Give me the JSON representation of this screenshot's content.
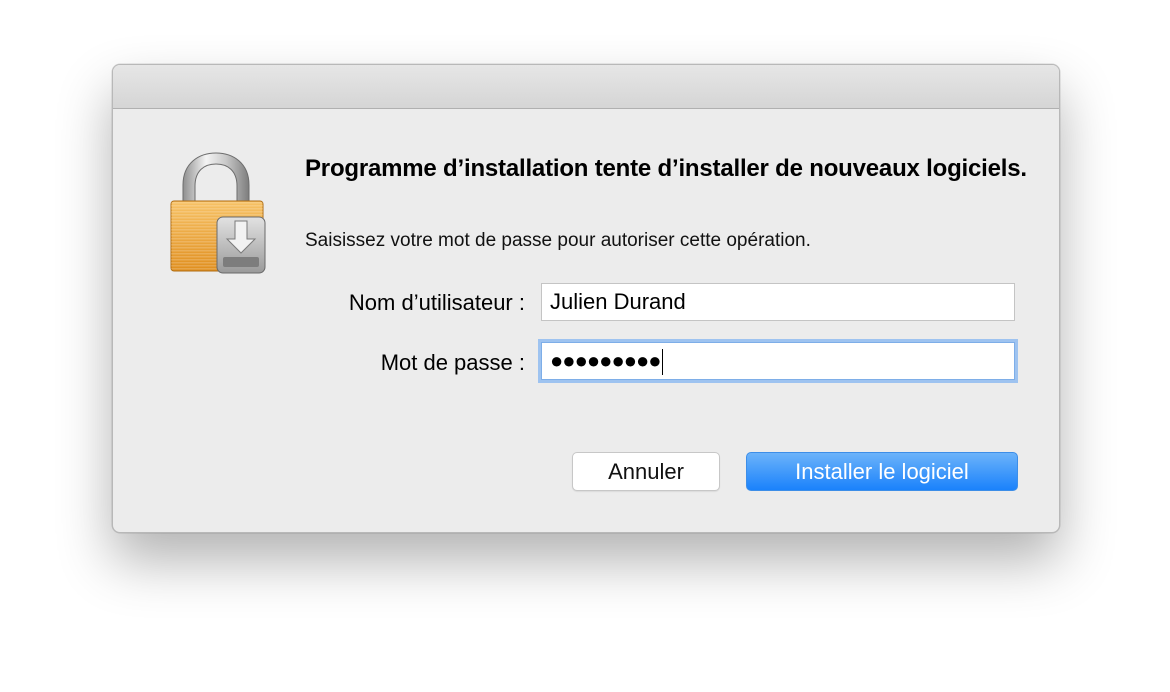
{
  "dialog": {
    "heading": "Programme d’installation tente d’installer de nouveaux logiciels.",
    "subtitle": "Saisissez votre mot de passe pour autoriser cette opération.",
    "icon": "lock-with-download-icon",
    "fields": {
      "username_label": "Nom d’utilisateur :",
      "username_value": "Julien Durand",
      "password_label": "Mot de passe :",
      "password_masked": "●●●●●●●●●"
    },
    "buttons": {
      "cancel_label": "Annuler",
      "confirm_label": "Installer le logiciel"
    }
  },
  "colors": {
    "dialog_bg": "#ececec",
    "accent": "#1a82fb",
    "focus_ring": "#9ec3f0",
    "lock_body": "#f0a93a"
  }
}
